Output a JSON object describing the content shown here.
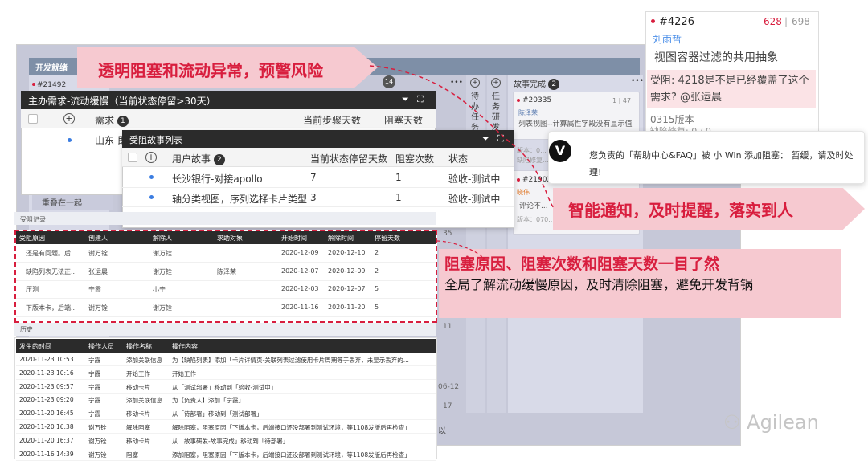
{
  "board": {
    "columns": [
      {
        "title": "开发就绪"
      },
      {
        "title": "故事完成",
        "count": "2"
      }
    ],
    "collapsed_cols": [
      "待办任务",
      "任务研发"
    ],
    "cards": {
      "c1_id": "#21492",
      "c2_id": "#20335",
      "c2_label": "陈泽荣",
      "c2_count": "1 | 47",
      "c2_text": "列表视图--计算属性字段没有显示值",
      "c3_text": "版本：0...",
      "c3_label": "缺陷修复...",
      "c4_id": "#21902",
      "c4_tag": "晓伟",
      "c4_text": "评论不...",
      "c4_ver": "版本：070...",
      "num_35": "35",
      "num_11": "11",
      "num_17": "17",
      "date_frag": "06-12",
      "num_14": "14"
    },
    "footer_label": "重叠在一起",
    "bottom_frag": "以"
  },
  "banners": {
    "top": "透明阻塞和流动异常，预警风险",
    "middle": "智能通知，及时提醒，落实到人",
    "right_title": "阻塞原因、阻塞次数和阻塞天数一目了然",
    "right_body": "全局了解流动缓慢原因，及时清除阻塞，避免开发背锅"
  },
  "panel1": {
    "title": "主办需求-流动缓慢（当前状态停留>30天）",
    "col_req": "需求",
    "col_req_count": "1",
    "col_days": "当前步骤天数",
    "col_blocked": "阻塞天数",
    "row1": "山东-即..."
  },
  "panel2": {
    "title": "受阻故事列表",
    "col_story": "用户故事",
    "col_story_count": "2",
    "col_stay": "当前状态停留天数",
    "col_times": "阻塞次数",
    "col_status": "状态",
    "rows": [
      {
        "name": "长沙银行-对接apollo",
        "stay": "7",
        "times": "1",
        "status": "验收-测试中"
      },
      {
        "name": "轴分类视图，序列选择卡片类型",
        "stay": "3",
        "times": "1",
        "status": "验收-测试中"
      }
    ]
  },
  "block_records": {
    "section": "受阻记录",
    "headers": [
      "受阻原因",
      "创建人",
      "解除人",
      "求助对象",
      "开始时间",
      "解除时间",
      "停留天数"
    ],
    "rows": [
      [
        "还是有问题。后...",
        "谢万铨",
        "谢万铨",
        "",
        "2020-12-09",
        "2020-12-10",
        "2"
      ],
      [
        "缺陷列表无法正...",
        "张运晨",
        "谢万铨",
        "陈泽荣",
        "2020-12-07",
        "2020-12-09",
        "2"
      ],
      [
        "压测",
        "宁霞",
        "小宁",
        "",
        "2020-12-03",
        "2020-12-07",
        "5"
      ],
      [
        "下版本卡，后端...",
        "谢万铨",
        "谢万铨",
        "",
        "2020-11-16",
        "2020-11-20",
        "5"
      ]
    ]
  },
  "history": {
    "section": "历史",
    "headers": [
      "发生的时间",
      "操作人员",
      "操作名称",
      "操作内容"
    ],
    "rows": [
      [
        "2020-11-23 10:53",
        "宁霞",
        "添加关联信息",
        "为【缺陷列表】添加「卡片详情页-关联列表过滤使用卡片周期等于丢弃，未显示丢弃的..."
      ],
      [
        "2020-11-23 10:16",
        "宁霞",
        "开始工作",
        "开始工作"
      ],
      [
        "2020-11-23 09:57",
        "宁霞",
        "移动卡片",
        "从「测试部署」移动到「验收-测试中」"
      ],
      [
        "2020-11-23 09:20",
        "宁霞",
        "添加关联信息",
        "为【负责人】添加「宁霞」"
      ],
      [
        "2020-11-20 16:45",
        "宁霞",
        "移动卡片",
        "从「待部署」移动到「测试部署」"
      ],
      [
        "2020-11-20 16:38",
        "谢万铨",
        "解除阻塞",
        "解除阻塞，阻塞原因「下版本卡，后端接口还没部署到测试环境，等1108发版后再检查」"
      ],
      [
        "2020-11-20 16:37",
        "谢万铨",
        "移动卡片",
        "从「故事研发-故事完成」移动到「待部署」"
      ],
      [
        "2020-11-16 14:39",
        "谢万铨",
        "阻塞",
        "添加阻塞，阻塞原因「下版本卡，后端接口还没部署到测试环境，等1108发版后再检查」"
      ]
    ]
  },
  "topcard": {
    "id": "#4226",
    "count_red": "628",
    "sep": "|",
    "count_gray": "698",
    "author": "刘雨哲",
    "title": "视图容器过滤的共用抽象",
    "comment": "受阻: 4218是不是已经覆盖了这个需求? @张运晨",
    "version": "0315版本",
    "defect": "缺陷修复: 0 / 0"
  },
  "notification": {
    "text": "您负责的「帮助中心&FAQ」被 小 Win 添加阻塞： 暂缓，请及时处理!"
  },
  "watermark": "Agilean",
  "colors": {
    "accent": "#d81e3e",
    "pink_banner": "#f6c9d0",
    "dark": "#2b2b2b",
    "link": "#3b7de1"
  }
}
